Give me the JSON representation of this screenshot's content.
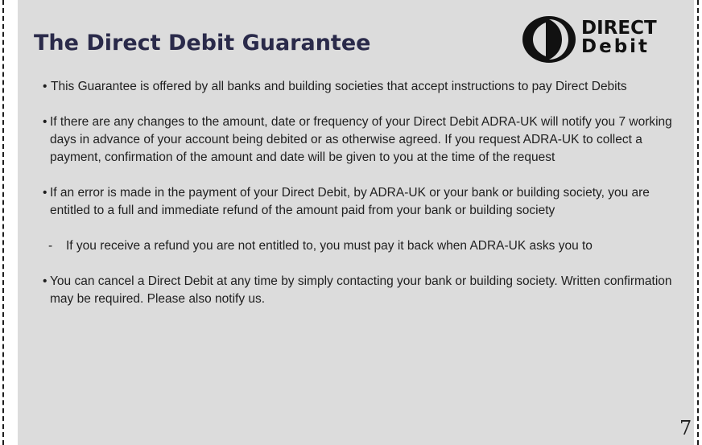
{
  "title": "The Direct Debit Guarantee",
  "logo": {
    "name": "direct-debit-logo",
    "line1": "DIRECT",
    "line2": "Debit"
  },
  "items": [
    {
      "marker": "•",
      "text": "This Guarantee is offered by all banks and building societies that accept instructions to pay Direct Debits"
    },
    {
      "marker": "•",
      "text": "If there are any changes to the amount, date or frequency of your Direct Debit ADRA-UK will notify you 7 working days in advance of your account being debited or as otherwise agreed. If you request ADRA-UK to collect a payment, confirmation of the amount and date will be given to you at the time of the request"
    },
    {
      "marker": "•",
      "text": "If an error is made in the payment of your Direct Debit, by ADRA-UK or your bank or building society, you are entitled to a full and immediate refund of the amount paid from your bank or building society"
    },
    {
      "marker": "-",
      "text": "If you receive a refund you are not entitled to, you must pay it back when ADRA-UK asks you to"
    },
    {
      "marker": "•",
      "text": "You can cancel a Direct Debit at any time by simply contacting your bank or building society. Written confirmation may be required. Please also notify us."
    }
  ],
  "page_number": "7",
  "colors": {
    "panel_bg": "#dcdcdc",
    "title": "#2a2a4a",
    "text": "#1f1f1f"
  }
}
